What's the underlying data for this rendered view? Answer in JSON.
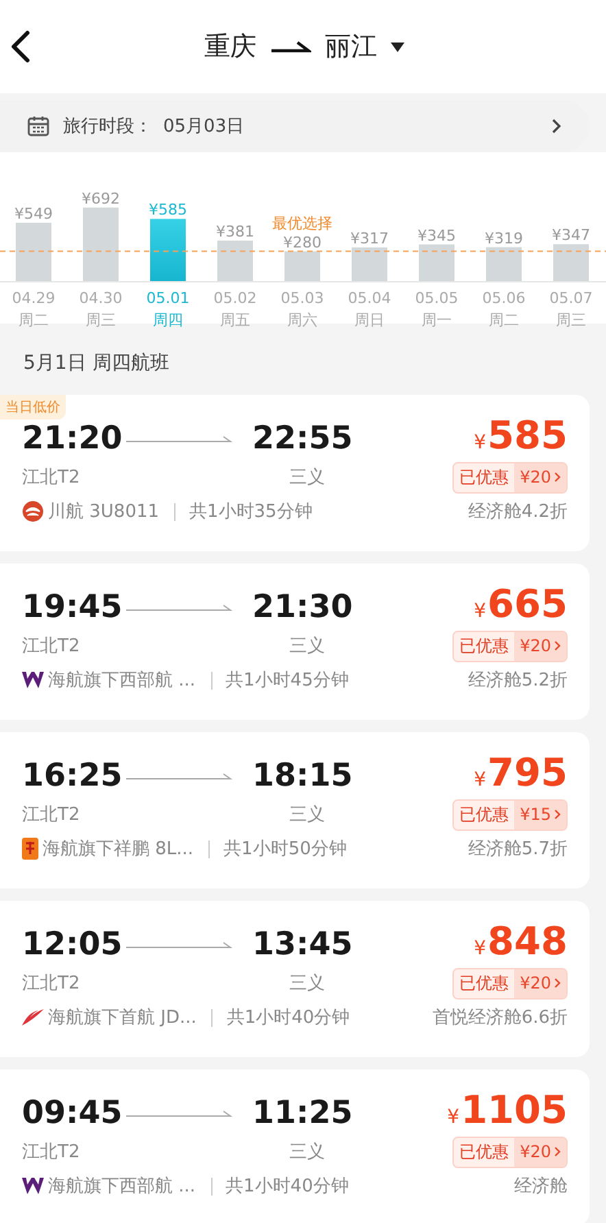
{
  "header": {
    "from": "重庆",
    "to": "丽江"
  },
  "travel_period": {
    "label": "旅行时段：",
    "value": "05月03日"
  },
  "price_chart": {
    "chart_data": {
      "type": "bar",
      "categories": [
        "04.29",
        "04.30",
        "05.01",
        "05.02",
        "05.03",
        "05.04",
        "05.05",
        "05.06",
        "05.07"
      ],
      "values": [
        549,
        692,
        585,
        381,
        280,
        317,
        345,
        319,
        347
      ],
      "value_labels": [
        "¥549",
        "¥692",
        "¥585",
        "¥381",
        "¥280",
        "¥317",
        "¥345",
        "¥319",
        "¥347"
      ],
      "ref_lines": [
        {
          "axis": "y",
          "value": 280
        }
      ],
      "annotations": [
        "最优选择"
      ]
    }
  },
  "days": [
    {
      "weekday": "周二",
      "selected": false
    },
    {
      "weekday": "周三",
      "selected": false
    },
    {
      "weekday": "周四",
      "selected": true
    },
    {
      "weekday": "周五",
      "selected": false
    },
    {
      "weekday": "周六",
      "selected": false
    },
    {
      "weekday": "周日",
      "selected": false
    },
    {
      "weekday": "周一",
      "selected": false
    },
    {
      "weekday": "周二",
      "selected": false
    },
    {
      "weekday": "周三",
      "selected": false
    }
  ],
  "section_title": "5月1日 周四航班",
  "flights": [
    {
      "tag": "当日低价",
      "dep_time": "21:20",
      "arr_time": "22:55",
      "dep_airport": "江北T2",
      "arr_airport": "三义",
      "currency": "¥",
      "price": "585",
      "discount_label": "已优惠",
      "discount": "¥20",
      "kind": "sichuan",
      "airline": "川航 3U8011",
      "duration": "共1小时35分钟",
      "cabin": "经济舱4.2折"
    },
    {
      "dep_time": "19:45",
      "arr_time": "21:30",
      "dep_airport": "江北T2",
      "arr_airport": "三义",
      "currency": "¥",
      "price": "665",
      "discount_label": "已优惠",
      "discount": "¥20",
      "kind": "west",
      "airline": "海航旗下西部航 ...",
      "duration": "共1小时45分钟",
      "cabin": "经济舱5.2折"
    },
    {
      "dep_time": "16:25",
      "arr_time": "18:15",
      "dep_airport": "江北T2",
      "arr_airport": "三义",
      "currency": "¥",
      "price": "795",
      "discount_label": "已优惠",
      "discount": "¥15",
      "kind": "lucky",
      "airline": "海航旗下祥鹏 8L...",
      "duration": "共1小时50分钟",
      "cabin": "经济舱5.7折"
    },
    {
      "dep_time": "12:05",
      "arr_time": "13:45",
      "dep_airport": "江北T2",
      "arr_airport": "三义",
      "currency": "¥",
      "price": "848",
      "discount_label": "已优惠",
      "discount": "¥20",
      "kind": "capital",
      "airline": "海航旗下首航 JD...",
      "duration": "共1小时40分钟",
      "cabin": "首悦经济舱6.6折"
    },
    {
      "dep_time": "09:45",
      "arr_time": "11:25",
      "dep_airport": "江北T2",
      "arr_airport": "三义",
      "currency": "¥",
      "price": "1105",
      "discount_label": "已优惠",
      "discount": "¥20",
      "kind": "west",
      "airline": "海航旗下西部航 ...",
      "duration": "共1小时40分钟",
      "cabin": "经济舱"
    }
  ]
}
